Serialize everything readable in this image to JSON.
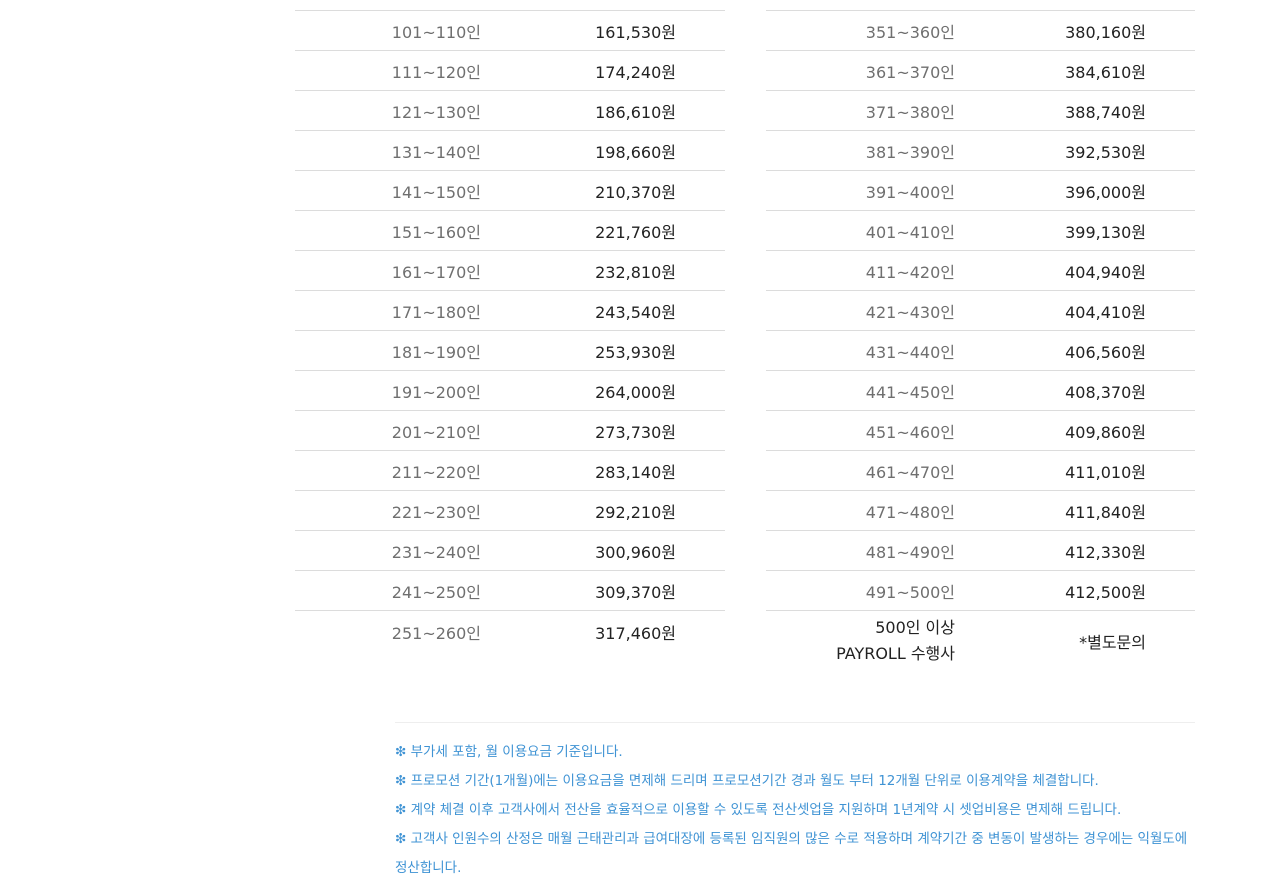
{
  "left_table": {
    "rows": [
      {
        "range": "101~110인",
        "price": "161,530원"
      },
      {
        "range": "111~120인",
        "price": "174,240원"
      },
      {
        "range": "121~130인",
        "price": "186,610원"
      },
      {
        "range": "131~140인",
        "price": "198,660원"
      },
      {
        "range": "141~150인",
        "price": "210,370원"
      },
      {
        "range": "151~160인",
        "price": "221,760원"
      },
      {
        "range": "161~170인",
        "price": "232,810원"
      },
      {
        "range": "171~180인",
        "price": "243,540원"
      },
      {
        "range": "181~190인",
        "price": "253,930원"
      },
      {
        "range": "191~200인",
        "price": "264,000원"
      },
      {
        "range": "201~210인",
        "price": "273,730원"
      },
      {
        "range": "211~220인",
        "price": "283,140원"
      },
      {
        "range": "221~230인",
        "price": "292,210원"
      },
      {
        "range": "231~240인",
        "price": "300,960원"
      },
      {
        "range": "241~250인",
        "price": "309,370원"
      },
      {
        "range": "251~260인",
        "price": "317,460원"
      }
    ]
  },
  "right_table": {
    "rows": [
      {
        "range": "351~360인",
        "price": "380,160원"
      },
      {
        "range": "361~370인",
        "price": "384,610원"
      },
      {
        "range": "371~380인",
        "price": "388,740원"
      },
      {
        "range": "381~390인",
        "price": "392,530원"
      },
      {
        "range": "391~400인",
        "price": "396,000원"
      },
      {
        "range": "401~410인",
        "price": "399,130원"
      },
      {
        "range": "411~420인",
        "price": "404,940원"
      },
      {
        "range": "421~430인",
        "price": "404,410원"
      },
      {
        "range": "431~440인",
        "price": "406,560원"
      },
      {
        "range": "441~450인",
        "price": "408,370원"
      },
      {
        "range": "451~460인",
        "price": "409,860원"
      },
      {
        "range": "461~470인",
        "price": "411,010원"
      },
      {
        "range": "471~480인",
        "price": "411,840원"
      },
      {
        "range": "481~490인",
        "price": "412,330원"
      },
      {
        "range": "491~500인",
        "price": "412,500원"
      }
    ],
    "last": {
      "range_line1": "500인 이상",
      "range_line2": "PAYROLL 수행사",
      "price": "*별도문의"
    }
  },
  "notes": [
    "❇ 부가세 포함, 월 이용요금 기준입니다.",
    "❇ 프로모션 기간(1개월)에는 이용요금을 면제해 드리며 프로모션기간 경과 월도 부터 12개월 단위로 이용계약을 체결합니다.",
    "❇ 계약 체결 이후 고객사에서 전산을 효율적으로 이용할 수 있도록 전산셋업을 지원하며 1년계약 시 셋업비용은 면제해 드립니다.",
    "❇ 고객사 인원수의 산정은 매월 근태관리과 급여대장에 등록된 임직원의 많은 수로 적용하며 계약기간 중 변동이 발생하는 경우에는 익월도에",
    "정산합니다."
  ],
  "colors": {
    "note_text": "#3f93d4",
    "range_text": "#6f6f6f",
    "price_text": "#222222",
    "row_divider": "#dcdcdc"
  }
}
